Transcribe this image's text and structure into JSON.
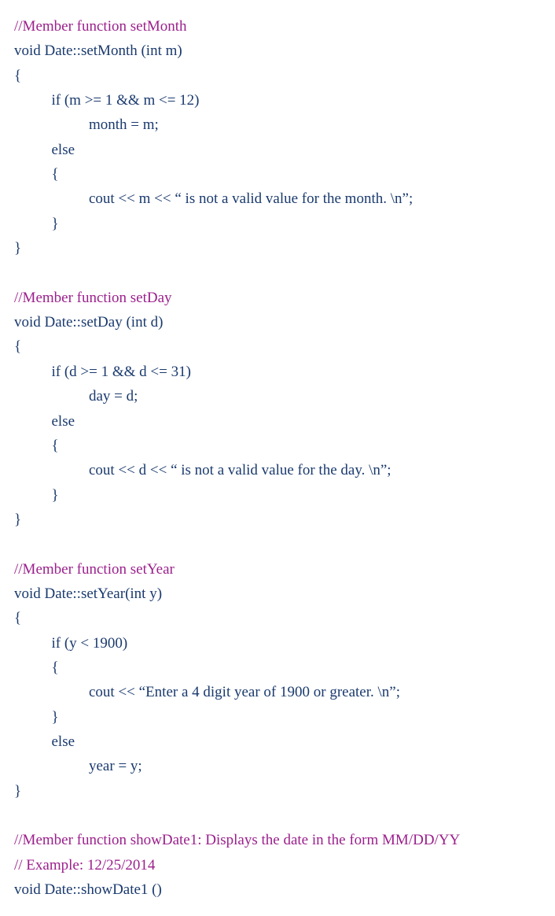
{
  "lines": [
    {
      "cls": "comment",
      "text": "//Member function setMonth"
    },
    {
      "cls": "code",
      "text": "void Date::setMonth (int m)"
    },
    {
      "cls": "code",
      "text": "{"
    },
    {
      "cls": "code",
      "text": "          if (m >= 1 && m <= 12)"
    },
    {
      "cls": "code",
      "text": "                    month = m;"
    },
    {
      "cls": "code",
      "text": "          else"
    },
    {
      "cls": "code",
      "text": "          {"
    },
    {
      "cls": "code",
      "text": "                    cout << m << “ is not a valid value for the month. \\n”;"
    },
    {
      "cls": "code",
      "text": "          }"
    },
    {
      "cls": "code",
      "text": "}"
    },
    {
      "cls": "blank",
      "text": ""
    },
    {
      "cls": "comment",
      "text": "//Member function setDay"
    },
    {
      "cls": "code",
      "text": "void Date::setDay (int d)"
    },
    {
      "cls": "code",
      "text": "{"
    },
    {
      "cls": "code",
      "text": "          if (d >= 1 && d <= 31)"
    },
    {
      "cls": "code",
      "text": "                    day = d;"
    },
    {
      "cls": "code",
      "text": "          else"
    },
    {
      "cls": "code",
      "text": "          {"
    },
    {
      "cls": "code",
      "text": "                    cout << d << “ is not a valid value for the day. \\n”;"
    },
    {
      "cls": "code",
      "text": "          }"
    },
    {
      "cls": "code",
      "text": "}"
    },
    {
      "cls": "blank",
      "text": ""
    },
    {
      "cls": "comment",
      "text": "//Member function setYear"
    },
    {
      "cls": "code",
      "text": "void Date::setYear(int y)"
    },
    {
      "cls": "code",
      "text": "{"
    },
    {
      "cls": "code",
      "text": "          if (y < 1900)"
    },
    {
      "cls": "code",
      "text": "          {"
    },
    {
      "cls": "code",
      "text": "                    cout << “Enter a 4 digit year of 1900 or greater. \\n”;"
    },
    {
      "cls": "code",
      "text": "          }"
    },
    {
      "cls": "code",
      "text": "          else"
    },
    {
      "cls": "code",
      "text": "                    year = y;"
    },
    {
      "cls": "code",
      "text": "}"
    },
    {
      "cls": "blank",
      "text": ""
    },
    {
      "cls": "comment",
      "text": "//Member function showDate1: Displays the date in the form MM/DD/YY"
    },
    {
      "cls": "comment",
      "text": "// Example: 12/25/2014"
    },
    {
      "cls": "code",
      "text": "void Date::showDate1 ()"
    }
  ]
}
